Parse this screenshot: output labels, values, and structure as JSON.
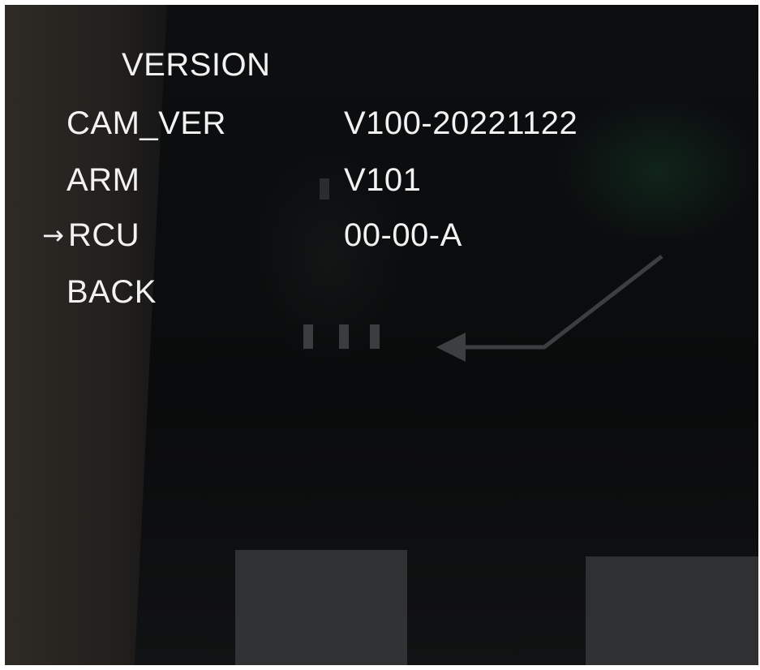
{
  "menu": {
    "title": "VERSION",
    "cursor_glyph": "→",
    "items": [
      {
        "label": "CAM_VER",
        "value": "V100-20221122"
      },
      {
        "label": "ARM",
        "value": "V101"
      },
      {
        "label": "RCU",
        "value": "00-00-A",
        "selected": true
      },
      {
        "label": "BACK",
        "value": ""
      }
    ]
  },
  "colors": {
    "osd_text": "#f2f2f2",
    "screen_background": "#0d0f11"
  }
}
